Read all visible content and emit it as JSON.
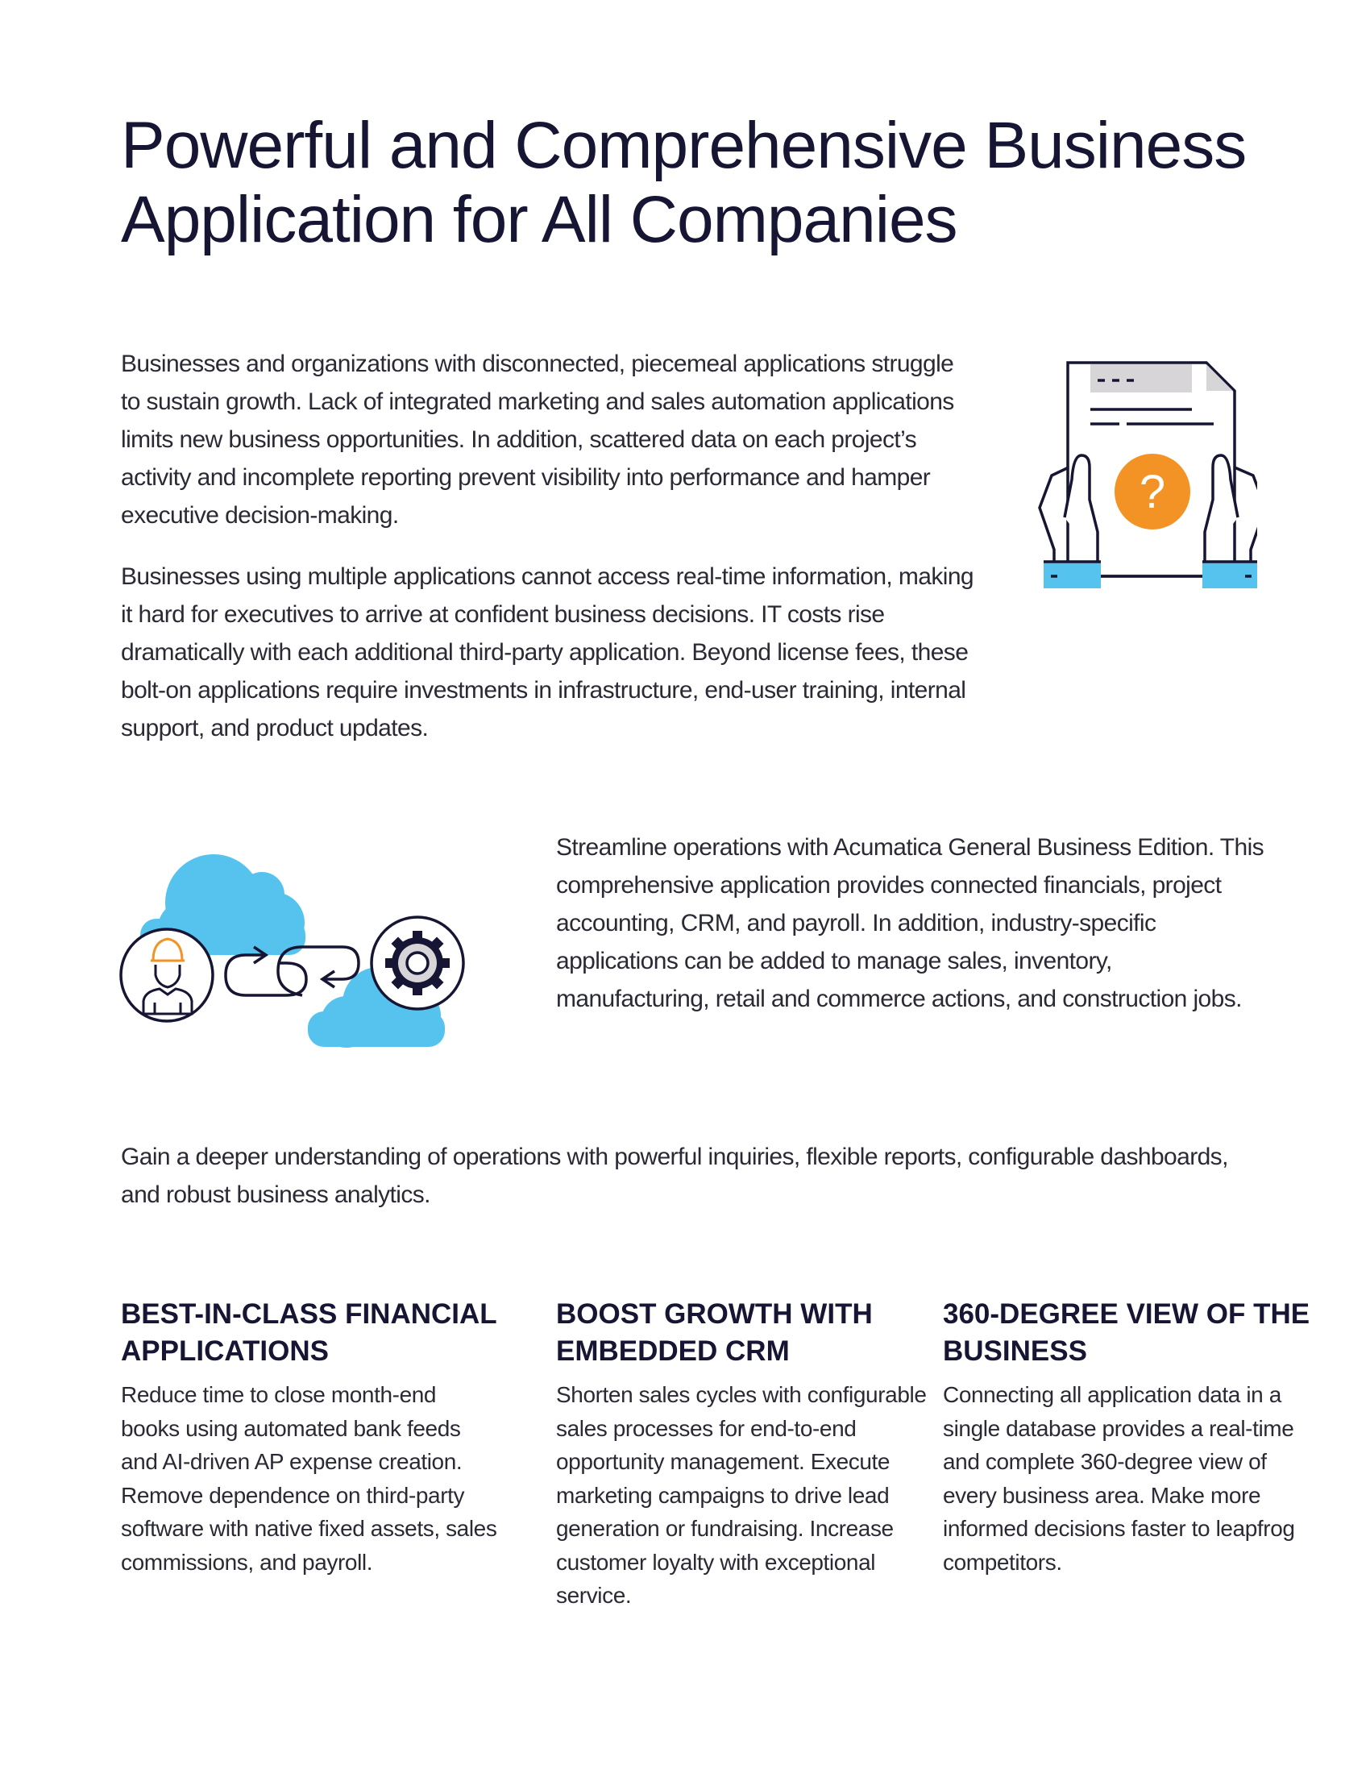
{
  "page": {
    "title": "Powerful and Comprehensive Business Application for All Companies",
    "intro_paragraphs": [
      "Businesses and organizations with disconnected, piecemeal applications struggle to sustain growth. Lack of integrated marketing and sales automation applications limits new business opportunities. In addition, scattered data on each project’s activity and incomplete reporting prevent visibility into performance and hamper executive decision-making.",
      "Businesses using multiple applications cannot access real-time information, making it hard for executives to arrive at confident business decisions. IT costs rise dramatically with each additional third-party application. Beyond license fees, these bolt-on applications require investments in infrastructure, end-user training, internal support, and product updates."
    ],
    "streamline_paragraph": "Streamline operations with Acumatica General Business Edition. This comprehensive application provides connected financials, project accounting, CRM, and payroll. In addition, industry-specific applications can be added to manage sales, inventory, manufacturing, retail and commerce actions, and construction jobs.",
    "insight_paragraph": "Gain a deeper understanding of operations with powerful inquiries, flexible reports, configurable dashboards, and robust business analytics.",
    "features": [
      {
        "heading": "BEST-IN-CLASS FINANCIAL APPLICATIONS",
        "body": "Reduce time to close month-end books using automated bank feeds and AI-driven AP expense creation. Remove dependence on third-party software with native fixed assets, sales commissions, and payroll."
      },
      {
        "heading": "BOOST GROWTH WITH EMBEDDED CRM",
        "body": "Shorten sales cycles with configurable sales processes for end-to-end opportunity management. Execute marketing campaigns to drive lead generation or fundraising. Increase customer loyalty with exceptional service."
      },
      {
        "heading": "360-DEGREE VIEW OF THE BUSINESS",
        "body": "Connecting all application data in a single database provides a real-time and complete 360-degree view of every business area. Make more informed decisions faster to leapfrog competitors."
      }
    ],
    "illustrations": {
      "document": {
        "icon": "document-question-icon",
        "question_mark": "?"
      },
      "integration": {
        "icon": "cloud-integration-icon"
      }
    },
    "colors": {
      "navy": "#161634",
      "orange": "#f39325",
      "sky_blue": "#56c3ef",
      "light_gray": "#d7d5d8"
    }
  }
}
